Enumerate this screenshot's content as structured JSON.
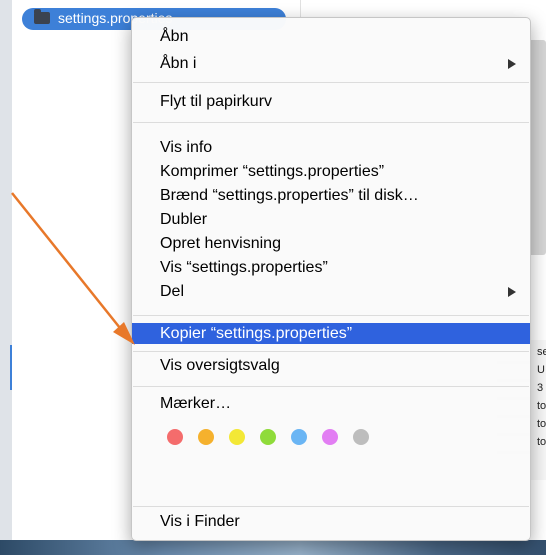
{
  "file": {
    "name": "settings.properties"
  },
  "menu": {
    "items": [
      {
        "label": "Åbn"
      },
      {
        "label": "Åbn i"
      },
      {
        "label": "Flyt til papirkurv"
      },
      {
        "label": "Vis info"
      },
      {
        "label": "Komprimer “settings.properties”"
      },
      {
        "label": "Brænd “settings.properties” til disk…"
      },
      {
        "label": "Dubler"
      },
      {
        "label": "Opret henvisning"
      },
      {
        "label": "Vis “settings.properties”"
      },
      {
        "label": "Del"
      },
      {
        "label": "Kopier “settings.properties”"
      },
      {
        "label": "Vis oversigtsvalg"
      },
      {
        "label": "Mærker…"
      },
      {
        "label": "Vis i Finder"
      }
    ],
    "tag_colors": [
      "#f46c6c",
      "#f5b12d",
      "#f3e836",
      "#8fdb3a",
      "#6ab5f4",
      "#e27ef3",
      "#bdbdbd"
    ],
    "highlight_color": "#2f62de"
  },
  "info_panel": {
    "values": [
      "se",
      "U",
      "3",
      "to",
      "to",
      "to"
    ]
  },
  "annotation": {
    "arrow_color": "#e8782a"
  }
}
